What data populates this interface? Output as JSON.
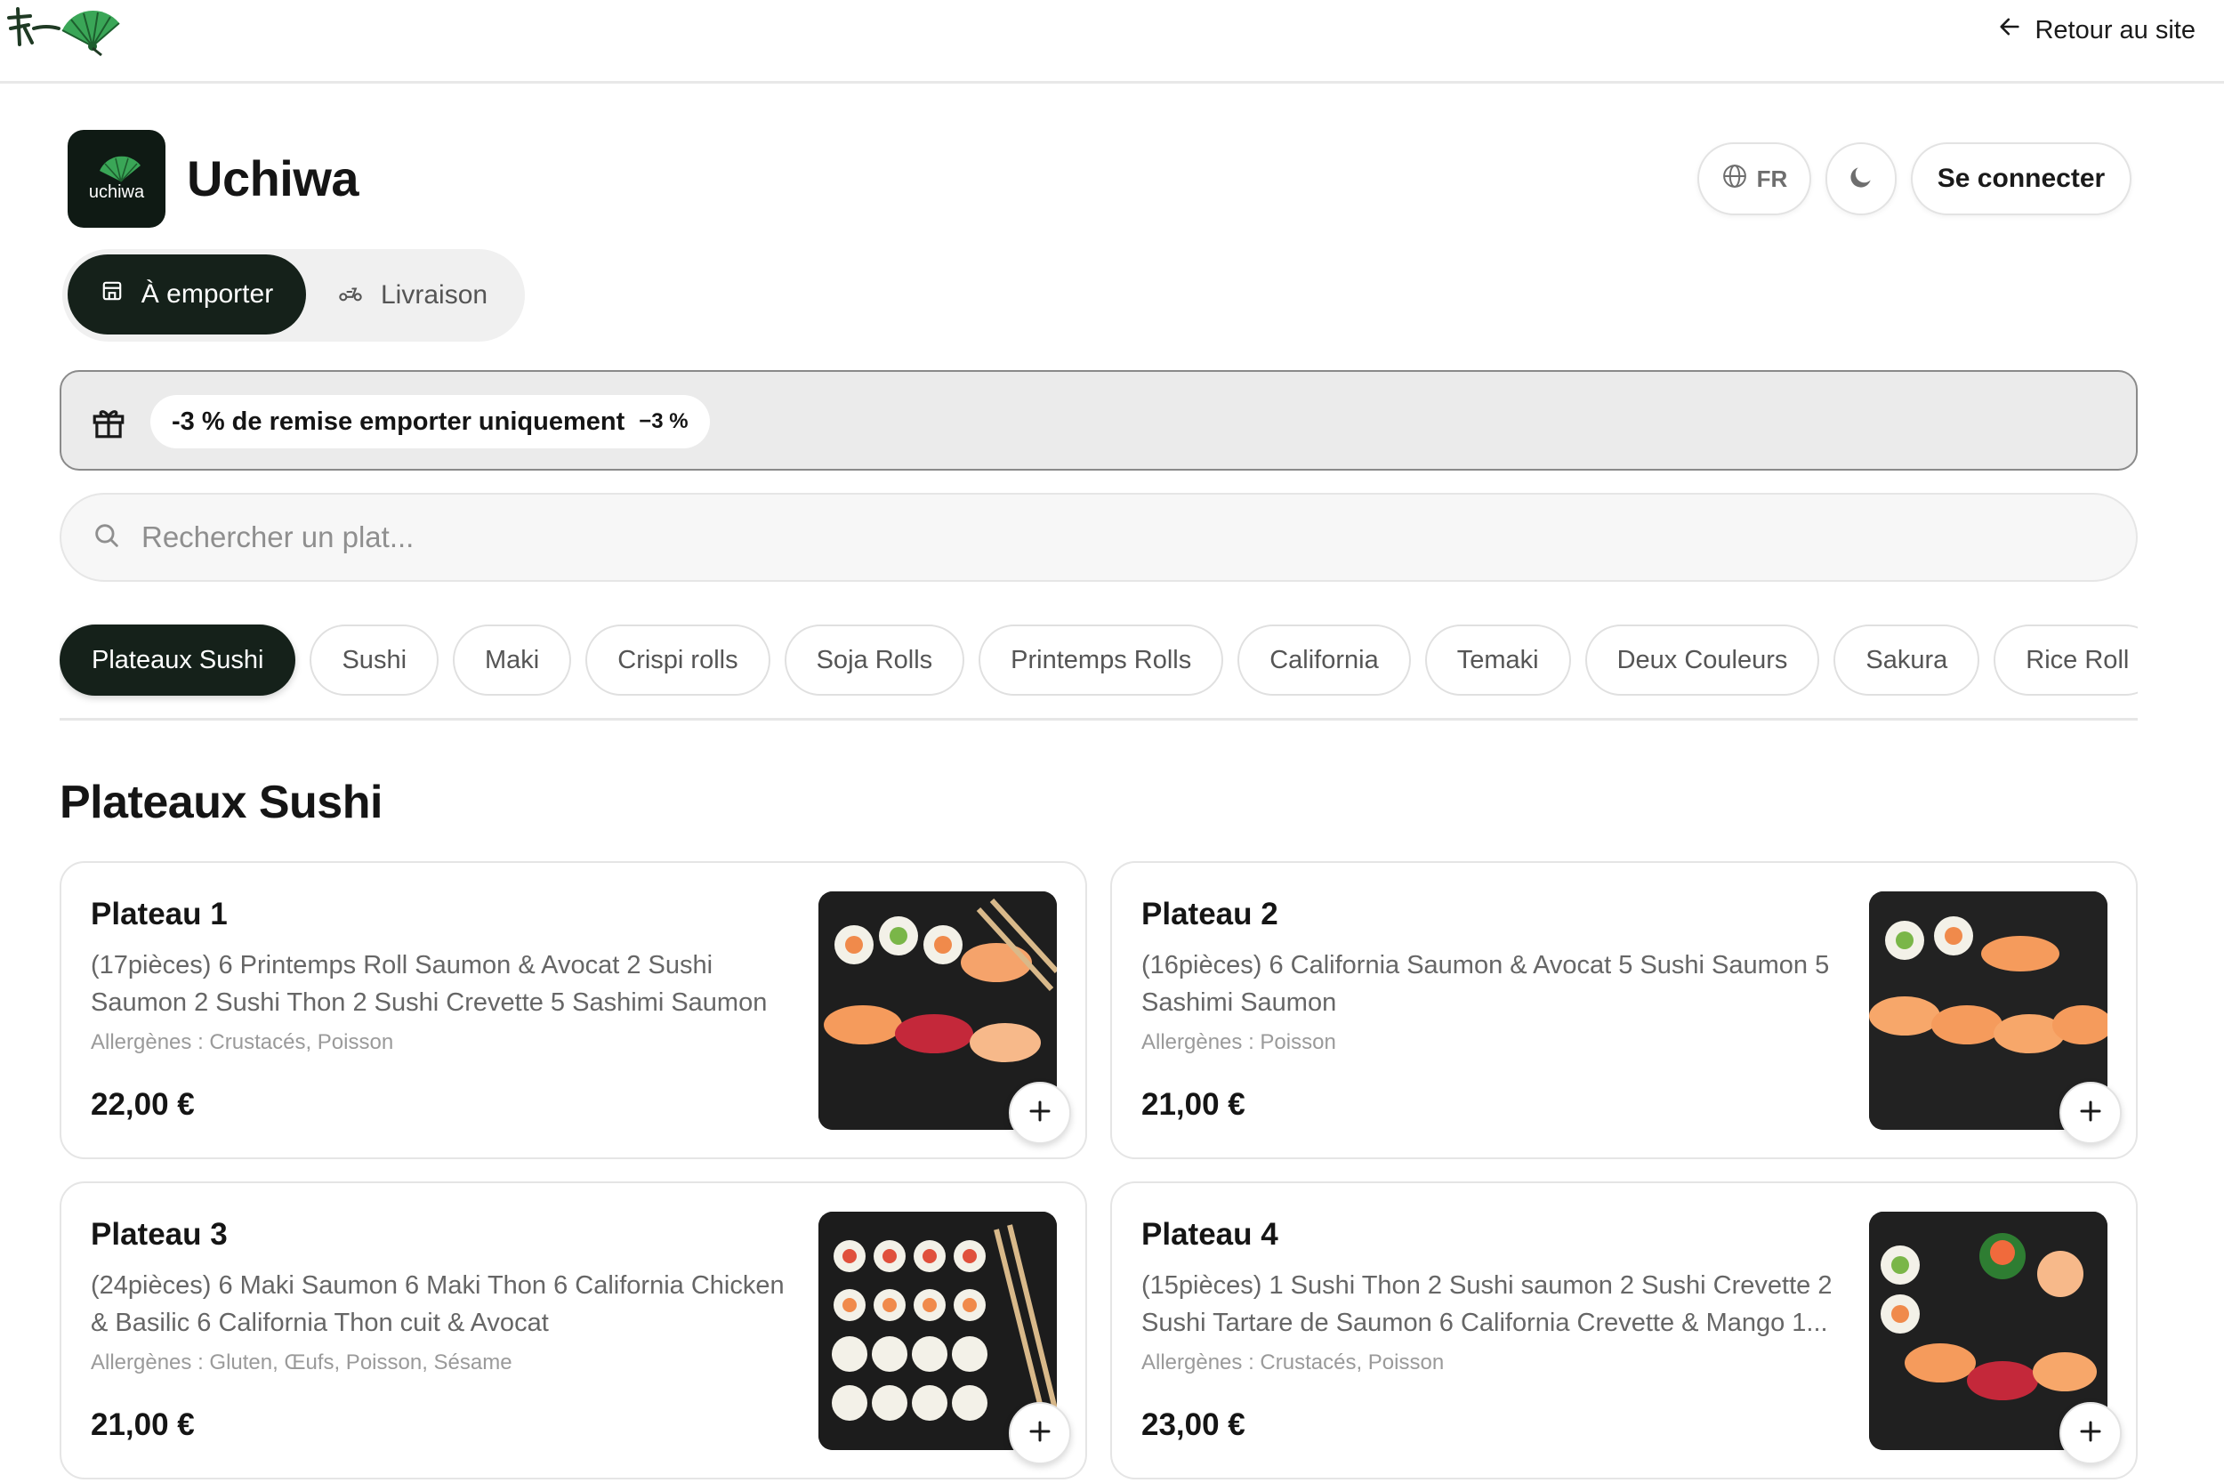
{
  "topbar": {
    "back_label": "Retour au site"
  },
  "header": {
    "logo_text": "uchiwa",
    "restaurant_name": "Uchiwa",
    "lang_label": "FR",
    "login_label": "Se connecter"
  },
  "mode": {
    "takeaway_label": "À emporter",
    "delivery_label": "Livraison"
  },
  "promo": {
    "text": "-3 % de remise emporter uniquement",
    "badge": "−3 %"
  },
  "search": {
    "placeholder": "Rechercher un plat..."
  },
  "categories": [
    "Plateaux Sushi",
    "Sushi",
    "Maki",
    "Crispi rolls",
    "Soja Rolls",
    "Printemps Rolls",
    "California",
    "Temaki",
    "Deux Couleurs",
    "Sakura",
    "Rice Roll"
  ],
  "section": {
    "title": "Plateaux Sushi"
  },
  "dishes": [
    {
      "title": "Plateau 1",
      "description": "(17pièces) 6 Printemps Roll Saumon & Avocat 2 Sushi Saumon 2 Sushi Thon 2 Sushi Crevette 5 Sashimi Saumon",
      "allergens": "Allergènes : Crustacés, Poisson",
      "price": "22,00 €"
    },
    {
      "title": "Plateau 2",
      "description": "(16pièces) 6 California Saumon & Avocat 5 Sushi Saumon 5 Sashimi Saumon",
      "allergens": "Allergènes : Poisson",
      "price": "21,00 €"
    },
    {
      "title": "Plateau 3",
      "description": "(24pièces) 6 Maki Saumon 6 Maki Thon 6 California Chicken & Basilic 6 California Thon cuit & Avocat",
      "allergens": "Allergènes : Gluten, Œufs, Poisson, Sésame",
      "price": "21,00 €"
    },
    {
      "title": "Plateau 4",
      "description": "(15pièces) 1 Sushi Thon 2 Sushi saumon 2 Sushi Crevette 2 Sushi Tartare de Saumon 6 California Crevette & Mango 1...",
      "allergens": "Allergènes : Crustacés, Poisson",
      "price": "23,00 €"
    }
  ],
  "colors": {
    "accent": "#15211a",
    "brand_green": "#3aa657"
  }
}
